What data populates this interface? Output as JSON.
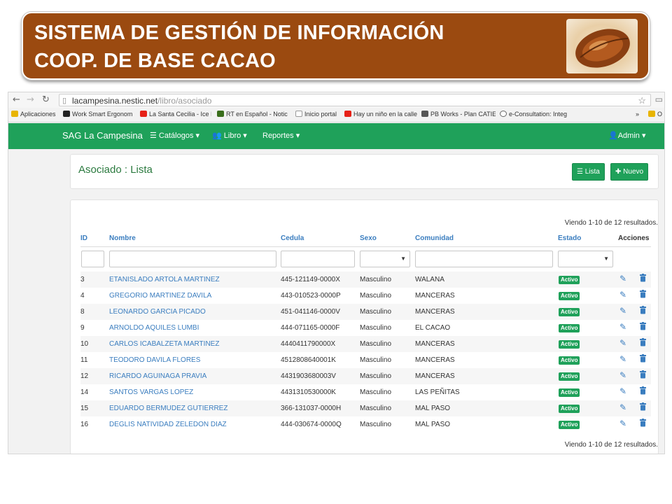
{
  "banner": {
    "line1": "SISTEMA DE GESTIÓN DE INFORMACIÓN",
    "line2": "COOP. DE BASE CACAO"
  },
  "browser": {
    "url_host": "lacampesina.nestic.net",
    "url_path": "/libro/asociado",
    "bookmarks": [
      {
        "label": "Aplicaciones",
        "color": "#e8b400"
      },
      {
        "label": "Work Smart Ergonom",
        "color": "#222222"
      },
      {
        "label": "La Santa Cecilia - Ice I",
        "color": "#e62117"
      },
      {
        "label": "RT en Español - Notic",
        "color": "#3a6e1c"
      },
      {
        "label": "Inicio portal",
        "color": "#9a9a9a"
      },
      {
        "label": "Hay un niño en la calle",
        "color": "#e62117"
      },
      {
        "label": "PB Works - Plan CATIE",
        "color": "#555555"
      },
      {
        "label": "e-Consultation: Integ",
        "color": "#666666"
      },
      {
        "label": "»",
        "color": ""
      },
      {
        "label": "O",
        "color": "#e8b400"
      }
    ]
  },
  "navbar": {
    "brand": "SAG La Campesina",
    "catalogos": "Catálogos",
    "libro": "Libro",
    "reportes": "Reportes",
    "admin": "Admin"
  },
  "page": {
    "title": "Asociado : Lista",
    "btn_lista": "Lista",
    "btn_nuevo": "Nuevo",
    "results_top": "Viendo 1-10 de 12 resultados.",
    "results_bottom": "Viendo 1-10 de 12 resultados."
  },
  "table": {
    "headers": {
      "id": "ID",
      "nombre": "Nombre",
      "cedula": "Cedula",
      "sexo": "Sexo",
      "comunidad": "Comunidad",
      "estado": "Estado",
      "acciones": "Acciones"
    },
    "rows": [
      {
        "id": "3",
        "nombre": "ETANISLADO ARTOLA MARTINEZ",
        "cedula": "445-121149-0000X",
        "sexo": "Masculino",
        "comunidad": "WALANA",
        "estado": "Activo"
      },
      {
        "id": "4",
        "nombre": "GREGORIO MARTINEZ DAVILA",
        "cedula": "443-010523-0000P",
        "sexo": "Masculino",
        "comunidad": "MANCERAS",
        "estado": "Activo"
      },
      {
        "id": "8",
        "nombre": "LEONARDO GARCIA PICADO",
        "cedula": "451-041146-0000V",
        "sexo": "Masculino",
        "comunidad": "MANCERAS",
        "estado": "Activo"
      },
      {
        "id": "9",
        "nombre": "ARNOLDO AQUILES LUMBI",
        "cedula": "444-071165-0000F",
        "sexo": "Masculino",
        "comunidad": "EL CACAO",
        "estado": "Activo"
      },
      {
        "id": "10",
        "nombre": "CARLOS ICABALZETA MARTINEZ",
        "cedula": "4440411790000X",
        "sexo": "Masculino",
        "comunidad": "MANCERAS",
        "estado": "Activo"
      },
      {
        "id": "11",
        "nombre": "TEODORO DAVILA FLORES",
        "cedula": "4512808640001K",
        "sexo": "Masculino",
        "comunidad": "MANCERAS",
        "estado": "Activo"
      },
      {
        "id": "12",
        "nombre": "RICARDO AGUINAGA PRAVIA",
        "cedula": "4431903680003V",
        "sexo": "Masculino",
        "comunidad": "MANCERAS",
        "estado": "Activo"
      },
      {
        "id": "14",
        "nombre": "SANTOS VARGAS LOPEZ",
        "cedula": "4431310530000K",
        "sexo": "Masculino",
        "comunidad": "LAS PEÑITAS",
        "estado": "Activo"
      },
      {
        "id": "15",
        "nombre": "EDUARDO BERMUDEZ GUTIERREZ",
        "cedula": "366-131037-0000H",
        "sexo": "Masculino",
        "comunidad": "MAL PASO",
        "estado": "Activo"
      },
      {
        "id": "16",
        "nombre": "DEGLIS NATIVIDAD ZELEDON DIAZ",
        "cedula": "444-030674-0000Q",
        "sexo": "Masculino",
        "comunidad": "MAL PASO",
        "estado": "Activo"
      }
    ]
  },
  "icons": {
    "edit": "pencil-icon",
    "delete": "trash-icon"
  }
}
